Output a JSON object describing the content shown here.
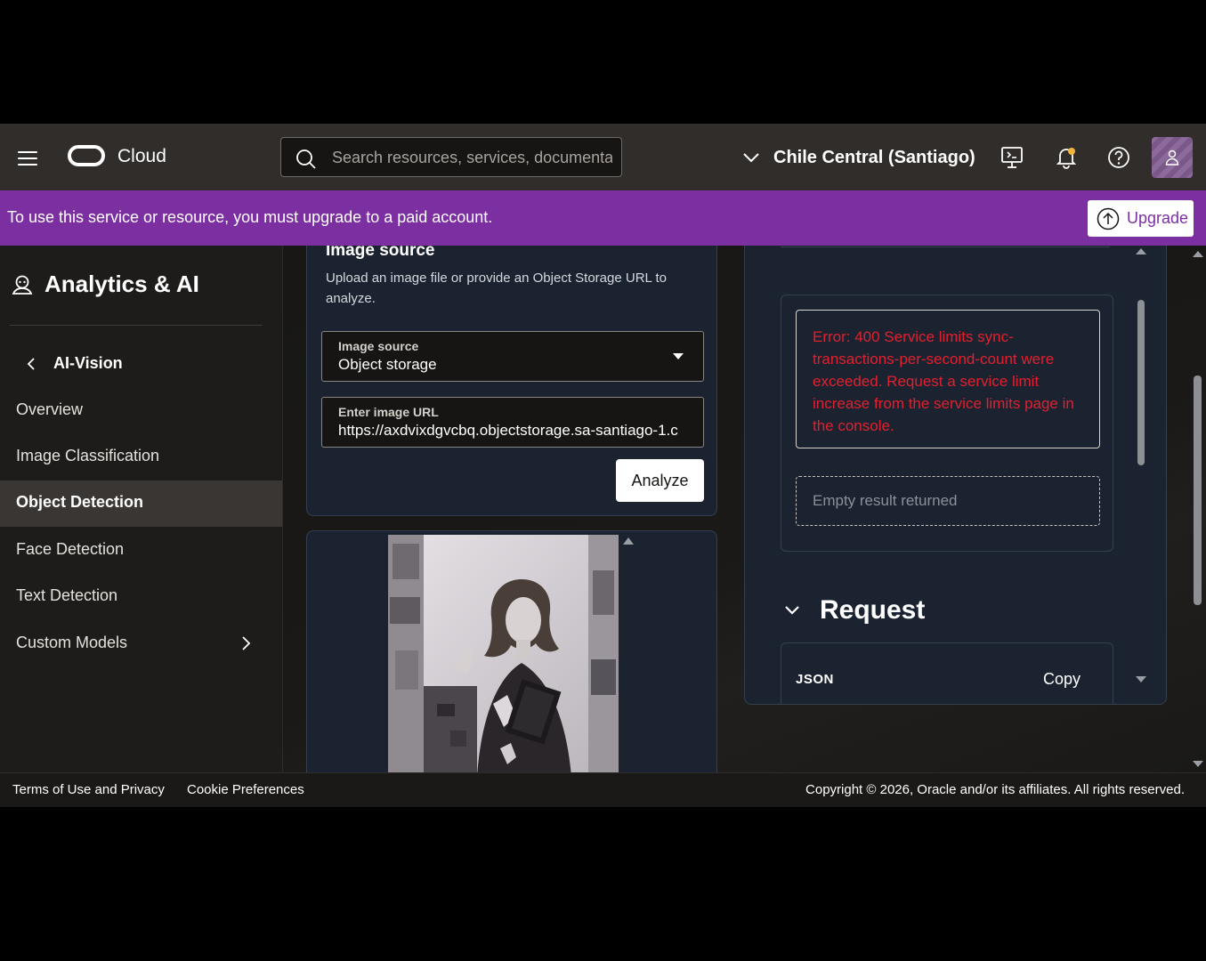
{
  "header": {
    "brand": "Cloud",
    "search_placeholder": "Search resources, services, documentation",
    "region": "Chile Central (Santiago)"
  },
  "banner": {
    "message": "To use this service or resource, you must upgrade to a paid account.",
    "upgrade_label": "Upgrade"
  },
  "sidebar": {
    "service_title": "Analytics & AI",
    "back_label": "AI-Vision",
    "items": [
      {
        "label": "Overview",
        "active": false
      },
      {
        "label": "Image Classification",
        "active": false
      },
      {
        "label": "Object Detection",
        "active": true
      },
      {
        "label": "Face Detection",
        "active": false
      },
      {
        "label": "Text Detection",
        "active": false
      },
      {
        "label": "Custom Models",
        "active": false,
        "has_submenu": true
      }
    ]
  },
  "image_source_card": {
    "heading": "Image source",
    "description": "Upload an image file or provide an Object Storage URL to analyze.",
    "source_select": {
      "label": "Image source",
      "value": "Object storage"
    },
    "url_field": {
      "label": "Enter image URL",
      "value": "https://axdvixdgvcbq.objectstorage.sa-santiago-1.c"
    },
    "analyze_label": "Analyze"
  },
  "results": {
    "error_message": "Error: 400 Service limits sync-transactions-per-second-count were exceeded. Request a service limit increase from the service limits page in the console.",
    "empty_message": "Empty result returned",
    "request_title": "Request",
    "json_label": "JSON",
    "copy_label": "Copy"
  },
  "footer": {
    "terms": "Terms of Use and Privacy",
    "cookies": "Cookie Preferences",
    "copyright": "Copyright © 2026, Oracle and/or its affiliates. All rights reserved."
  },
  "colors": {
    "header_bg": "#312d2a",
    "banner_bg": "#7b2fa0",
    "error_text": "#e0202f",
    "card_bg": "#1c2330"
  }
}
